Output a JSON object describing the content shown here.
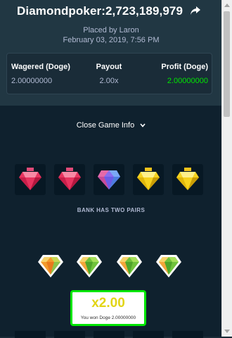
{
  "header": {
    "title": "Diamondpoker:2,723,189,979",
    "placed_by": "Placed by Laron",
    "date": "February 03, 2019, 7:56 PM"
  },
  "stats": [
    {
      "label": "Wagered (Doge)",
      "value": "2.00000000"
    },
    {
      "label": "Payout",
      "value": "2.00x"
    },
    {
      "label": "Profit (Doge)",
      "value": "2.00000000"
    }
  ],
  "close_game_info": "Close Game Info",
  "dealer_gems": [
    "red-gem-icon",
    "red-gem-icon",
    "purple-gem-icon",
    "yellow-gem-icon",
    "yellow-gem-icon"
  ],
  "result_text": "BANK HAS TWO PAIRS",
  "player_gems": [
    "orange-gem-icon",
    "green-gem-icon",
    "green-gem-icon",
    "green-gem-icon"
  ],
  "win": {
    "multiplier": "x2.00",
    "message": "You won Doge 2.00000000"
  },
  "colors": {
    "profit_green": "#00e701",
    "win_yellow": "#e2d516",
    "background": "#0f212e"
  }
}
